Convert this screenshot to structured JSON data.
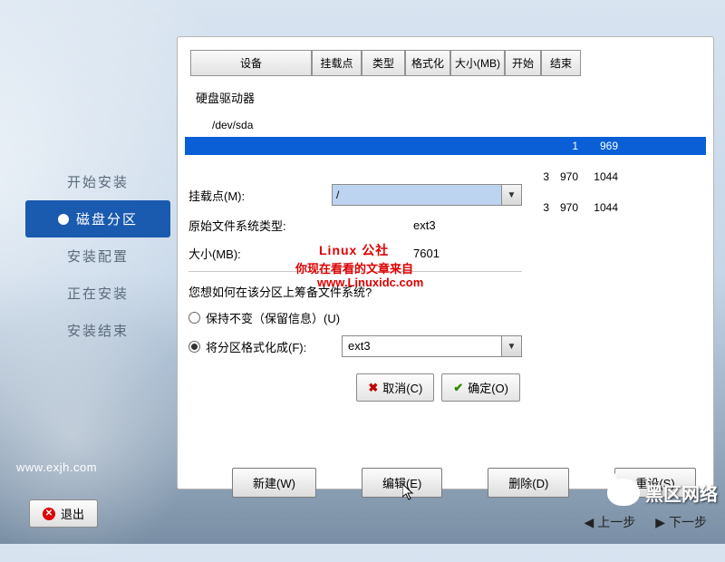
{
  "sidebar": {
    "items": [
      {
        "label": "开始安装"
      },
      {
        "label": "磁盘分区",
        "active": true
      },
      {
        "label": "安装配置"
      },
      {
        "label": "正在安装"
      },
      {
        "label": "安装结束"
      }
    ]
  },
  "site_url": "www.exjh.com",
  "table": {
    "headers": {
      "device": "设备",
      "mount": "挂载点",
      "type": "类型",
      "format": "格式化",
      "size": "大小(MB)",
      "start": "开始",
      "end": "结束"
    },
    "group": "硬盘驱动器",
    "device": "/dev/sda",
    "rows": [
      {
        "start": "1",
        "end": "969",
        "selected": true
      },
      {
        "size": "3",
        "start": "970",
        "end": "1044"
      },
      {
        "size": "3",
        "start": "970",
        "end": "1044"
      }
    ]
  },
  "dialog": {
    "mount_label": "挂载点(M):",
    "mount_value": "/",
    "fs_orig_label": "原始文件系统类型:",
    "fs_orig_value": "ext3",
    "size_label": "大小(MB):",
    "size_value": "7601",
    "question": "您想如何在该分区上筹备文件系统?",
    "radio_keep": "保持不变（保留信息）(U)",
    "radio_format": "将分区格式化成(F):",
    "format_value": "ext3",
    "cancel": "取消(C)",
    "ok": "确定(O)"
  },
  "watermark": {
    "line1": "Linux 公社",
    "line2": "你现在看看的文章来自",
    "line3": "www.Linuxidc.com"
  },
  "bottom": {
    "new": "新建(W)",
    "edit": "编辑(E)",
    "delete": "删除(D)",
    "reset": "重设(S)"
  },
  "nav": {
    "prev": "上一步",
    "next": "下一步"
  },
  "exit": "退出",
  "brand": "黑区网络"
}
